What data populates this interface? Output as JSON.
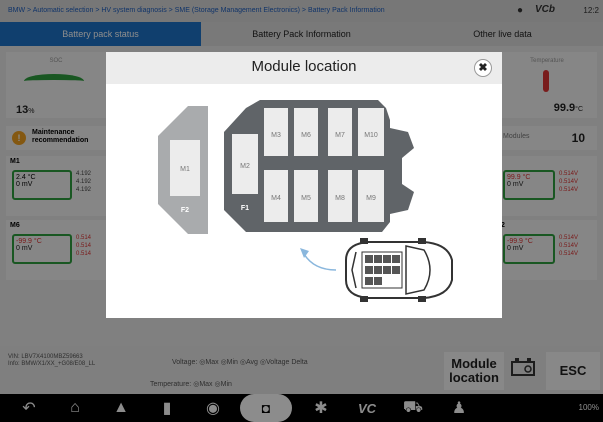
{
  "breadcrumb": "BMW > Automatic selection > HV system diagnosis > SME (Storage Management Electronics) > Battery Pack Information",
  "status_bar_top": {
    "brand": "VCb",
    "time": "12:2"
  },
  "tabs": [
    {
      "label": "Battery pack status",
      "active": true
    },
    {
      "label": "Battery Pack Information",
      "active": false
    },
    {
      "label": "Other live data",
      "active": false
    }
  ],
  "soc": {
    "label": "SOC",
    "value": "13",
    "unit": "%"
  },
  "temperature": {
    "label": "Temperature",
    "value": "99.9",
    "unit": "°C"
  },
  "maintenance": {
    "label_line1": "Maintenance",
    "label_line2": "recommendation"
  },
  "modules_card": {
    "label": "Modules",
    "value": "10"
  },
  "module_rows": [
    {
      "name": "M1",
      "temp": "2.4",
      "temp_unit": "°C",
      "mv": "0",
      "mv_unit": "mV",
      "v1": "4.192",
      "v2": "4.192",
      "v3": "4.192"
    },
    {
      "name": "M6",
      "temp": "-99.9",
      "temp_unit": "°C",
      "mv": "0",
      "mv_unit": "mV",
      "v1": "0.514",
      "v2": "0.514",
      "v3": "0.514"
    }
  ],
  "module_rows_right": [
    {
      "temp": "99.9",
      "temp_unit": "°C",
      "mv": "0",
      "mv_unit": "mV",
      "v1": "0.514V",
      "v2": "0.514V",
      "v3": "0.514V"
    },
    {
      "name": "2",
      "temp": "-99.9",
      "temp_unit": "°C",
      "mv": "0",
      "mv_unit": "mV",
      "v1": "0.514V",
      "v2": "0.514V",
      "v3": "0.514V"
    }
  ],
  "footer": {
    "vin_line1": "VIN: LBV7X4100MBZ59663",
    "vin_line2": "Info: BMW/X1/XX_+G08/E08_LL",
    "voltage_label": "Voltage:",
    "voltage_items": [
      "Max",
      "Min",
      "Avg",
      "Voltage Delta"
    ],
    "temperature_label": "Temperature:",
    "temperature_items": [
      "Max",
      "Min"
    ],
    "module_location_line1": "Module",
    "module_location_line2": "location",
    "esc": "ESC"
  },
  "navbar": {
    "status": "100%"
  },
  "modal": {
    "title": "Module location",
    "close_glyph": "✖",
    "frame_labels": {
      "f1": "F1",
      "f2": "F2"
    },
    "modules_front": [
      "M1",
      "M2"
    ],
    "modules_top": [
      "M3",
      "M6",
      "M7",
      "M10"
    ],
    "modules_bottom": [
      "M4",
      "M5",
      "M8",
      "M9"
    ]
  },
  "colors": {
    "accent": "#1e73c9",
    "pack_dark": "#606468",
    "pack_light": "#a9abad",
    "module_fill": "#ececec",
    "arrow": "#8ab7dd"
  }
}
